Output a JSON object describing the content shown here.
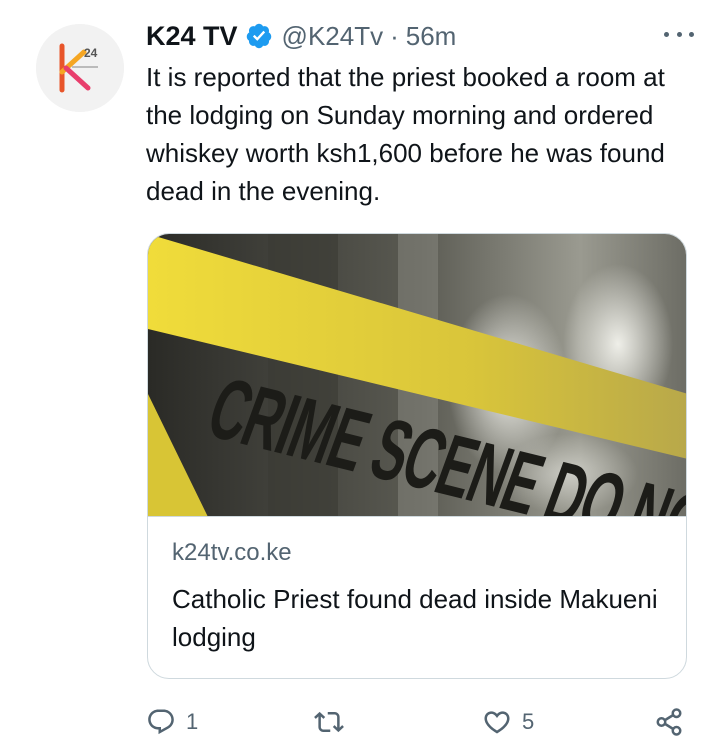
{
  "tweet": {
    "display_name": "K24 TV",
    "handle": "@K24Tv",
    "separator": "·",
    "time": "56m",
    "text": "It is reported that the priest booked a room at the lodging on Sunday morning and ordered whiskey worth ksh1,600 before he was found dead in the evening.",
    "avatar_logo": "24"
  },
  "card": {
    "image_subject": "crime-scene-tape-photo",
    "image_text": "CRIME SCENE DO NOT CROSS",
    "domain": "k24tv.co.ke",
    "title": "Catholic Priest found dead inside Makueni lodging"
  },
  "actions": {
    "reply_count": "1",
    "retweet_count": "",
    "like_count": "5"
  },
  "colors": {
    "verified": "#1d9bf0",
    "muted": "#536471",
    "tape": "#e9d53a"
  },
  "icons": [
    "verified-badge-icon",
    "more-options-icon",
    "reply-icon",
    "retweet-icon",
    "like-icon",
    "share-icon"
  ]
}
